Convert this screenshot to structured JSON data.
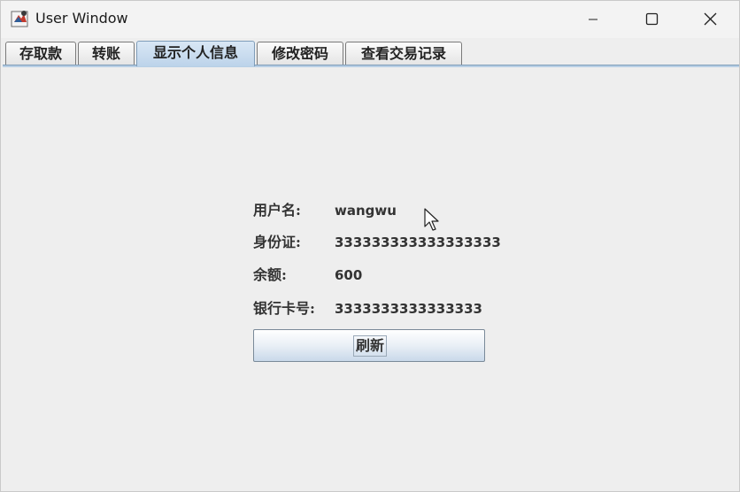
{
  "window": {
    "title": "User Window",
    "app_icon": "java-app-icon",
    "controls": {
      "minimize": "minimize-icon",
      "maximize": "maximize-icon",
      "close": "close-icon"
    }
  },
  "tabs": [
    {
      "label": "存取款",
      "selected": false
    },
    {
      "label": "转账",
      "selected": false
    },
    {
      "label": "显示个人信息",
      "selected": true
    },
    {
      "label": "修改密码",
      "selected": false
    },
    {
      "label": "查看交易记录",
      "selected": false
    }
  ],
  "info": {
    "username_label": "用户名:",
    "username_value": "wangwu",
    "id_label": "身份证:",
    "id_value": "333333333333333333",
    "balance_label": "余额:",
    "balance_value": "600",
    "card_label": "银行卡号:",
    "card_value": "3333333333333333"
  },
  "refresh_button": {
    "label": "刷新"
  },
  "colors": {
    "selected_tab": "#bcd3ea",
    "background": "#eeeeee",
    "button_gradient_bottom": "#c9d9ea"
  }
}
